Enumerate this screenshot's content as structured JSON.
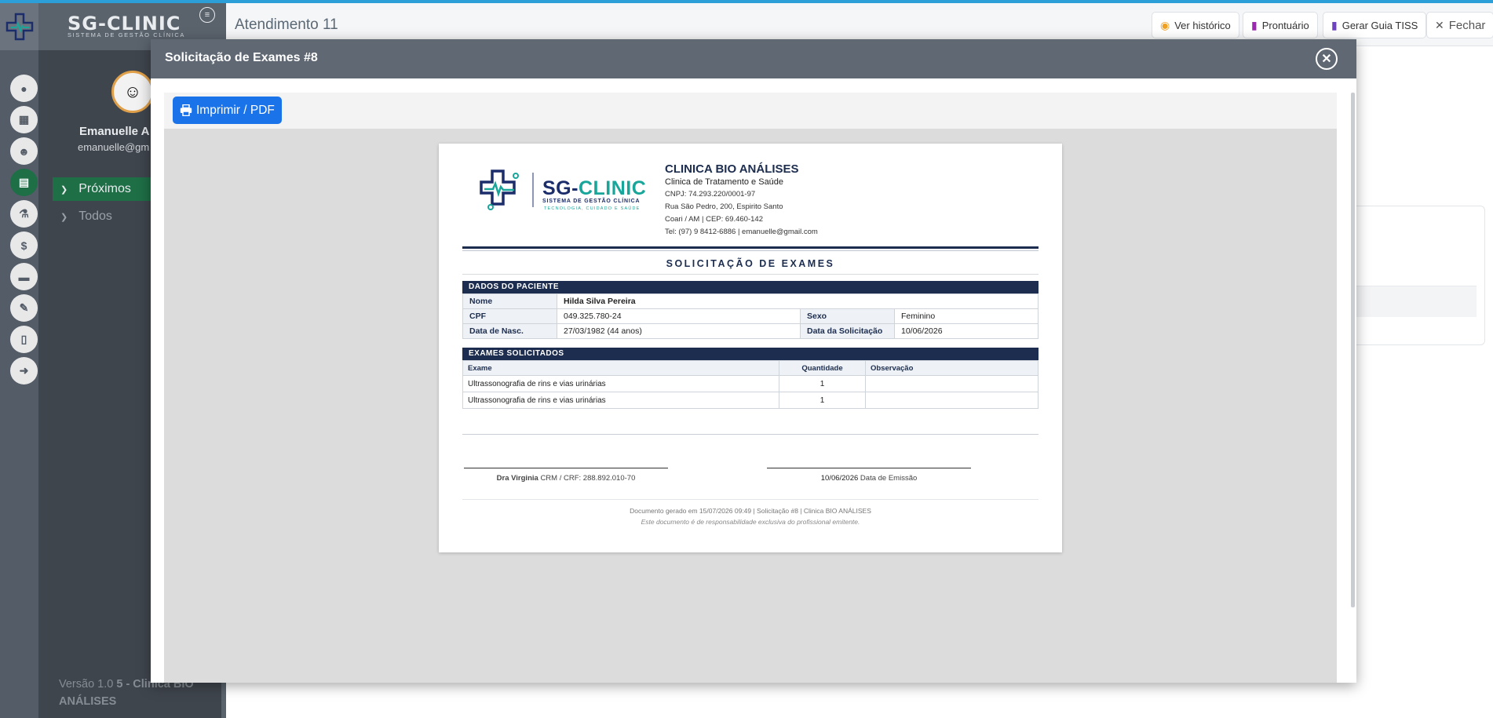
{
  "app": {
    "brand": "SG-CLINIC",
    "brand_sub": "SISTEMA DE GESTÃO CLÍNICA",
    "colors": {
      "accent": "#2c9fd9",
      "active": "#1e6e46",
      "primary_button": "#1a73e8",
      "doc_navy": "#1c2d4f",
      "teal": "#19a69a"
    }
  },
  "sidebar": {
    "user_name": "Emanuelle A",
    "user_email": "emanuelle@gm",
    "nav": [
      {
        "label": "Próximos"
      },
      {
        "label": "Todos"
      }
    ],
    "version_prefix": "Versão 1.0",
    "version_bold": "5 - Clinica BIO ANÁLISES",
    "rail_icons": [
      "user-icon",
      "calendar-icon",
      "users-icon",
      "clipboard-icon",
      "microscope-icon",
      "dollar-icon",
      "archive-icon",
      "edit-icon",
      "file-icon",
      "logout-icon"
    ]
  },
  "header": {
    "title": "Atendimento 11",
    "buttons": {
      "historico": "Ver histórico",
      "prontuario": "Prontuário",
      "guia": "Gerar Guia TISS",
      "fechar": "Fechar"
    }
  },
  "modal": {
    "title": "Solicitação de Exames #8",
    "print_label": "Imprimir / PDF"
  },
  "document": {
    "brand_sg": "SG-",
    "brand_clinic": "CLINIC",
    "brand_sub": "SISTEMA DE GESTÃO CLÍNICA",
    "brand_tag": "TECNOLOGIA, CUIDADO E SAÚDE",
    "clinic_name": "CLINICA BIO ANÁLISES",
    "clinic_sub": "Clinica de Tratamento e Saúde",
    "cnpj": "CNPJ: 74.293.220/0001-97",
    "address": "Rua São Pedro, 200, Espirito Santo",
    "city": "Coari / AM | CEP: 69.460-142",
    "contact": "Tel: (97) 9 8412-6886 | emanuelle@gmail.com",
    "doc_title": "SOLICITAÇÃO DE EXAMES",
    "patient_section": "DADOS DO PACIENTE",
    "patient": {
      "nome_label": "Nome",
      "nome": "Hilda Silva Pereira",
      "cpf_label": "CPF",
      "cpf": "049.325.780-24",
      "sexo_label": "Sexo",
      "sexo": "Feminino",
      "nasc_label": "Data de Nasc.",
      "nasc": "27/03/1982 (44 anos)",
      "solic_label": "Data da Solicitação",
      "solic": "10/06/2026"
    },
    "exams_section": "EXAMES SOLICITADOS",
    "exam_headers": {
      "exame": "Exame",
      "quantidade": "Quantidade",
      "observacao": "Observação"
    },
    "exams": [
      {
        "exame": "Ultrassonografia de rins e vias urinárias",
        "quantidade": "1",
        "observacao": ""
      },
      {
        "exame": "Ultrassonografia de rins e vias urinárias",
        "quantidade": "1",
        "observacao": ""
      }
    ],
    "signature": {
      "doctor_name": "Dra Virginia",
      "doctor_crm": "CRM / CRF: 288.892.010-70",
      "emission_date": "10/06/2026",
      "emission_label": "Data de Emissão"
    },
    "footer_line1": "Documento gerado em 15/07/2026 09:49  |  Solicitação #8  |  Clinica BIO ANÁLISES",
    "footer_line2": "Este documento é de responsabilidade exclusiva do profissional emitente."
  }
}
